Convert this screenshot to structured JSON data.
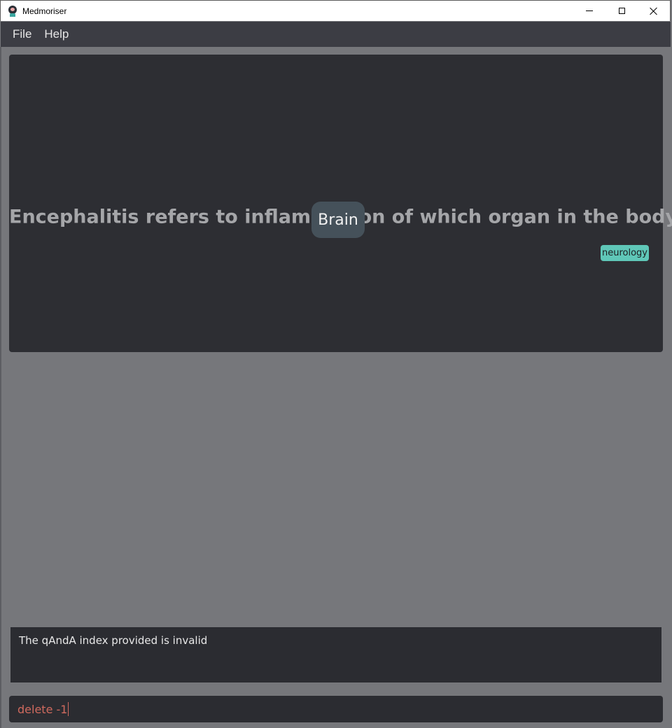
{
  "window": {
    "title": "Medmoriser",
    "controls": [
      "minimize",
      "maximize",
      "close"
    ]
  },
  "menu": {
    "items": [
      {
        "label": "File"
      },
      {
        "label": "Help"
      }
    ]
  },
  "card": {
    "question": "Encephalitis refers to inflammation of which organ in the body?",
    "answer": "Brain",
    "tag": "neurology"
  },
  "result": {
    "message": "The qAndA index provided is invalid"
  },
  "command": {
    "value": "delete -1"
  },
  "colors": {
    "background": "#76777b",
    "card": "#2d2e33",
    "menubar": "#3c3d44",
    "answer_bg": "#45515a",
    "tag_bg": "#5fc7b8",
    "error_text": "#d06a5e"
  },
  "icons": {
    "app": "medmoriser-head-icon"
  }
}
